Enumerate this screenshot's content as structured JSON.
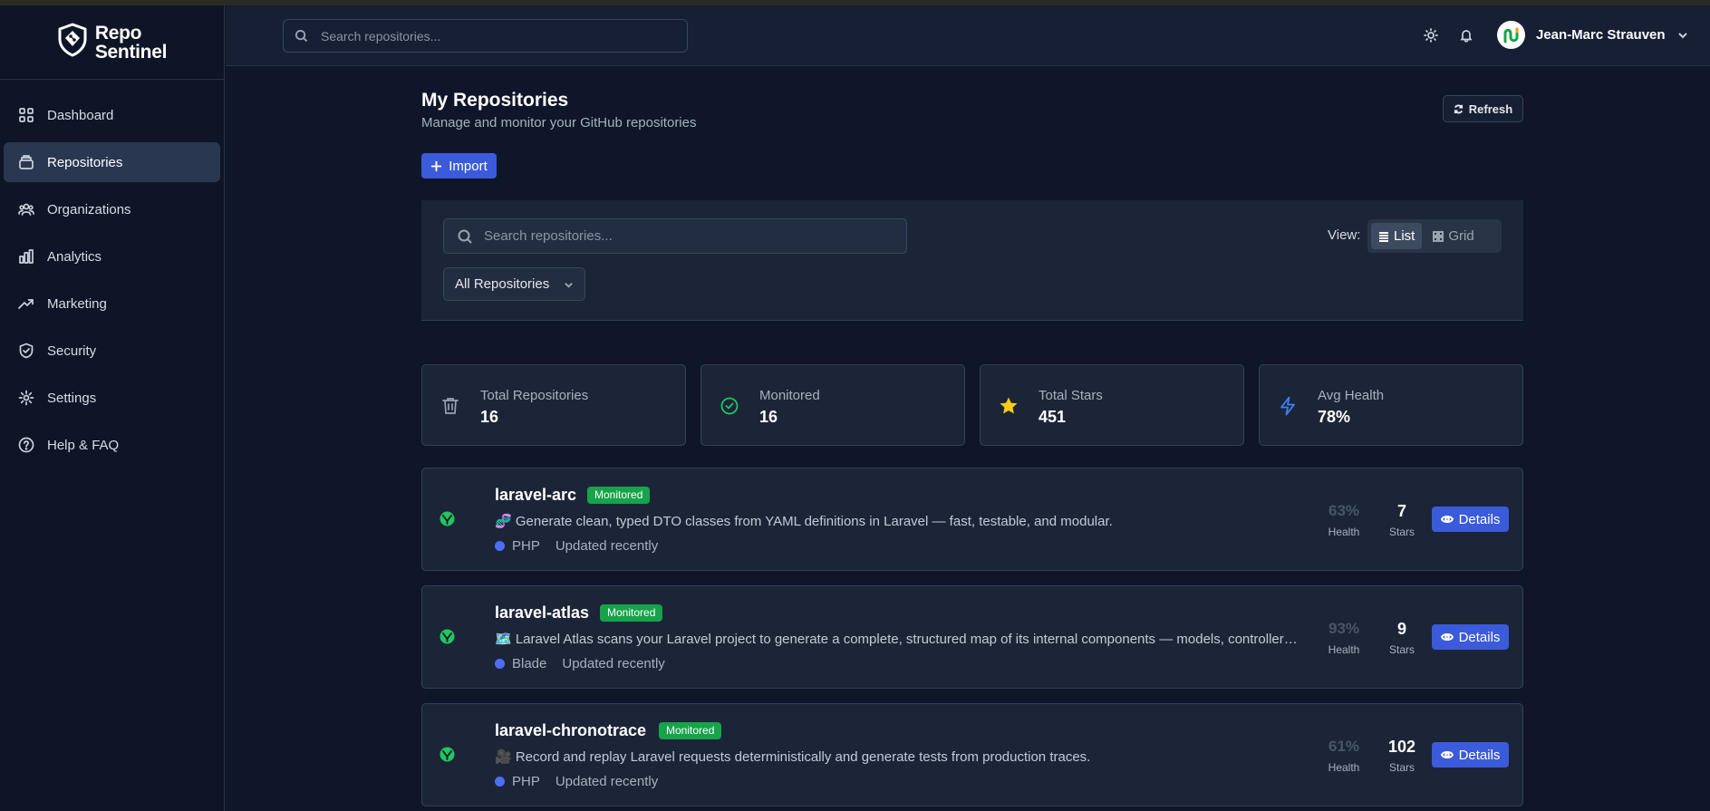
{
  "brand": {
    "line1": "Repo",
    "line2": "Sentinel",
    "logo_icon": "shield-icon"
  },
  "sidebar": {
    "items": [
      {
        "label": "Dashboard",
        "icon": "grid-icon"
      },
      {
        "label": "Repositories",
        "icon": "repo-icon",
        "active": true
      },
      {
        "label": "Organizations",
        "icon": "users-icon"
      },
      {
        "label": "Analytics",
        "icon": "bar-chart-icon"
      },
      {
        "label": "Marketing",
        "icon": "trending-up-icon"
      },
      {
        "label": "Security",
        "icon": "shield-check-icon"
      },
      {
        "label": "Settings",
        "icon": "gear-icon"
      },
      {
        "label": "Help & FAQ",
        "icon": "help-circle-icon"
      }
    ]
  },
  "header": {
    "search_placeholder": "Search repositories...",
    "user_name": "Jean-Marc Strauven"
  },
  "page": {
    "title": "My Repositories",
    "subtitle": "Manage and monitor your GitHub repositories",
    "refresh_label": "Refresh",
    "import_label": "Import"
  },
  "filters": {
    "search_placeholder": "Search repositories...",
    "select_value": "All Repositories",
    "view_label": "View:",
    "view_list": "List",
    "view_grid": "Grid"
  },
  "stats": [
    {
      "label": "Total Repositories",
      "value": "16",
      "icon": "trash-icon"
    },
    {
      "label": "Monitored",
      "value": "16",
      "icon": "check-circle-icon"
    },
    {
      "label": "Total Stars",
      "value": "451",
      "icon": "star-icon"
    },
    {
      "label": "Avg Health",
      "value": "78%",
      "icon": "lightning-icon"
    }
  ],
  "repos": [
    {
      "name": "laravel-arc",
      "badge": "Monitored",
      "description": "🧬 Generate clean, typed DTO classes from YAML definitions in Laravel — fast, testable, and modular.",
      "language": "PHP",
      "updated": "Updated recently",
      "health": "63%",
      "health_label": "Health",
      "stars": "7",
      "stars_label": "Stars",
      "details_label": "Details"
    },
    {
      "name": "laravel-atlas",
      "badge": "Monitored",
      "description": "🗺️ Laravel Atlas scans your Laravel project to generate a complete, structured map of its internal components — models, controllers, routes, jobs, observers, events, commands, and more.",
      "language": "Blade",
      "updated": "Updated recently",
      "health": "93%",
      "health_label": "Health",
      "stars": "9",
      "stars_label": "Stars",
      "details_label": "Details"
    },
    {
      "name": "laravel-chronotrace",
      "badge": "Monitored",
      "description": "🎥 Record and replay Laravel requests deterministically and generate tests from production traces.",
      "language": "PHP",
      "updated": "Updated recently",
      "health": "61%",
      "health_label": "Health",
      "stars": "102",
      "stars_label": "Stars",
      "details_label": "Details"
    }
  ],
  "colors": {
    "accent": "#3b5bdb",
    "success": "#16a34a",
    "star": "#facc15",
    "check": "#22c55e",
    "lightning": "#3b82f6",
    "lang_dot": "#4c6ef5"
  }
}
